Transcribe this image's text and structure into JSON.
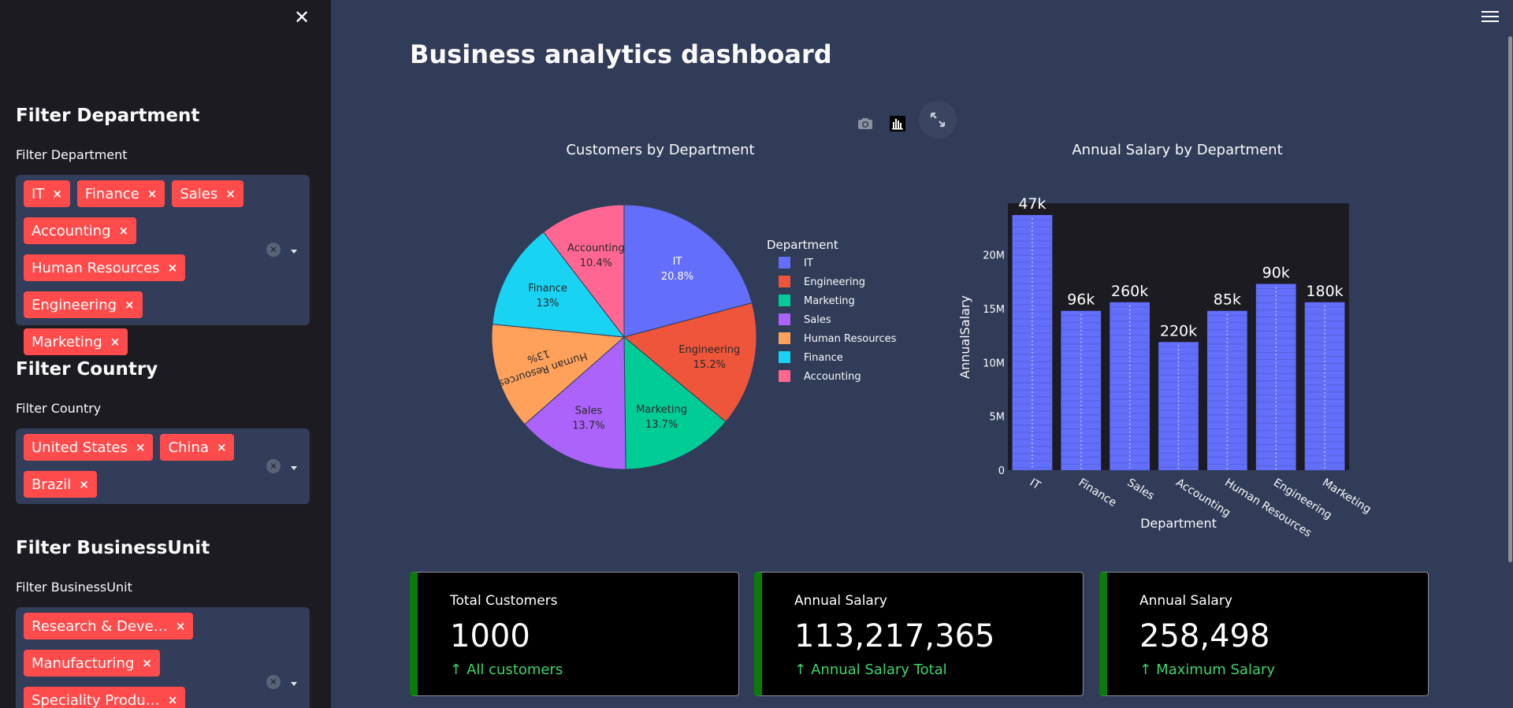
{
  "sidebar": {
    "sections": [
      {
        "heading": "Filter Department",
        "label": "Filter Department",
        "tags": [
          "IT",
          "Finance",
          "Sales",
          "Accounting",
          "Human Resources",
          "Engineering",
          "Marketing"
        ]
      },
      {
        "heading": "Filter Country",
        "label": "Filter Country",
        "tags": [
          "United States",
          "China",
          "Brazil"
        ]
      },
      {
        "heading": "Filter BusinessUnit",
        "label": "Filter BusinessUnit",
        "tags": [
          "Research & Deve…",
          "Manufacturing",
          "Speciality Produ…"
        ]
      }
    ],
    "close_icon": "close-icon",
    "clear_icon": "clear-icon",
    "dropdown_icon": "chevron-down-icon",
    "tag_remove_glyph": "×",
    "tag_color": "#ff4b4b"
  },
  "header": {
    "title": "Business analytics dashboard",
    "menu_icon": "hamburger-icon"
  },
  "toolbar": {
    "camera_icon": "camera-icon",
    "chart_icon": "bar-chart-icon",
    "fullscreen_icon": "fullscreen-icon"
  },
  "chart_data": [
    {
      "type": "pie",
      "title": "Customers by Department",
      "legend_title": "Department",
      "legend_position": "right",
      "categories": [
        "IT",
        "Engineering",
        "Marketing",
        "Sales",
        "Human Resources",
        "Finance",
        "Accounting"
      ],
      "values": [
        20.8,
        15.2,
        13.7,
        13.7,
        13,
        13,
        10.4
      ],
      "labels": [
        "20.8%",
        "15.2%",
        "13.7%",
        "13.7%",
        "13%",
        "13%",
        "10.4%"
      ],
      "colors": [
        "#636efa",
        "#ef553b",
        "#00cc96",
        "#ab63fa",
        "#ffa15a",
        "#19d3f3",
        "#ff6692"
      ]
    },
    {
      "type": "bar",
      "title": "Annual Salary by Department",
      "xlabel": "Department",
      "ylabel": "AnnualSalary",
      "categories": [
        "IT",
        "Finance",
        "Sales",
        "Accounting",
        "Human Resources",
        "Engineering",
        "Marketing"
      ],
      "values": [
        23700000,
        14800000,
        15600000,
        11900000,
        14800000,
        17300000,
        15600000
      ],
      "data_labels": [
        "47k",
        "96k",
        "260k",
        "220k",
        "85k",
        "90k",
        "180k"
      ],
      "yticks": [
        "0",
        "5M",
        "10M",
        "15M",
        "20M"
      ],
      "ylim": [
        0,
        24800000
      ],
      "color": "#636efa",
      "plot_background": "#1d1b22"
    }
  ],
  "metrics": [
    {
      "label": "Total Customers",
      "value": "1000",
      "delta": "All customers",
      "delta_color": "#3dd56d"
    },
    {
      "label": "Annual Salary",
      "value": "113,217,365",
      "delta": "Annual Salary Total",
      "delta_color": "#3dd56d"
    },
    {
      "label": "Annual Salary",
      "value": "258,498",
      "delta": "Maximum Salary",
      "delta_color": "#3dd56d"
    }
  ]
}
